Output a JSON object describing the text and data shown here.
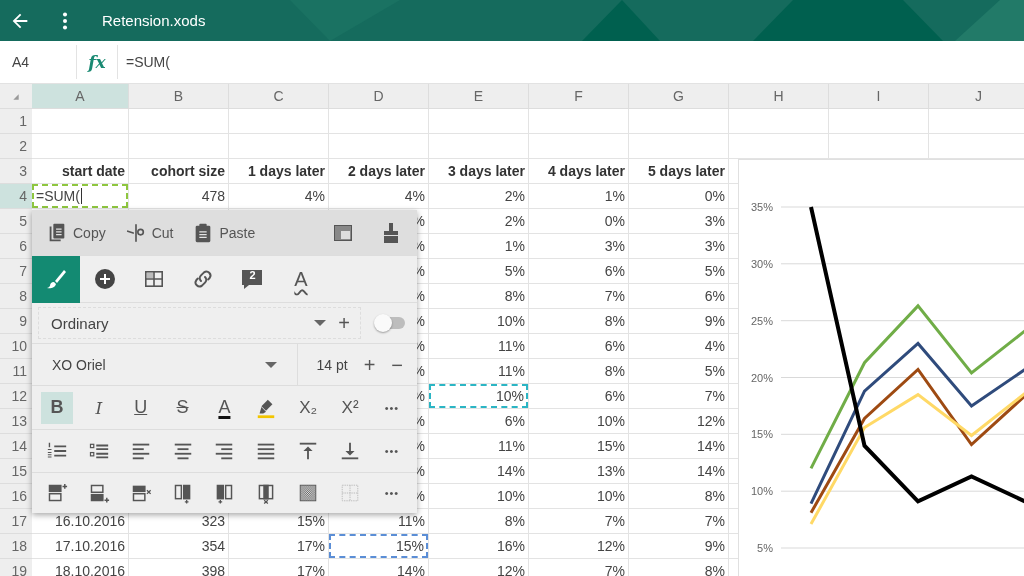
{
  "app_bar": {
    "title": "Retension.xods"
  },
  "formula_bar": {
    "cell_ref": "A4",
    "fx": "fx",
    "formula": "=SUM("
  },
  "sheet": {
    "columns": [
      {
        "label": "A",
        "selected": true
      },
      {
        "label": "B",
        "selected": false
      },
      {
        "label": "C",
        "selected": false
      },
      {
        "label": "D",
        "selected": false
      },
      {
        "label": "E",
        "selected": false
      },
      {
        "label": "F",
        "selected": false
      },
      {
        "label": "G",
        "selected": false
      },
      {
        "label": "H",
        "selected": false
      },
      {
        "label": "I",
        "selected": false
      },
      {
        "label": "J",
        "selected": false
      }
    ],
    "rows": [
      {
        "label": "1",
        "selected": false,
        "kind": "data",
        "cells": []
      },
      {
        "label": "2",
        "selected": false,
        "kind": "data",
        "cells": []
      },
      {
        "label": "3",
        "selected": false,
        "kind": "heading",
        "cells": [
          "start date",
          "cohort size",
          "1 days later",
          "2 days later",
          "3 days later",
          "4 days later",
          "5 days later"
        ]
      },
      {
        "label": "4",
        "selected": true,
        "kind": "data",
        "cells": [
          {
            "kind": "editing",
            "text": "=SUM("
          },
          "478",
          "4%",
          "4%",
          "2%",
          "1%",
          "0%"
        ]
      },
      {
        "label": "5",
        "selected": false,
        "kind": "data",
        "cells": [
          null,
          null,
          null,
          "%",
          "2%",
          "0%",
          "3%"
        ]
      },
      {
        "label": "6",
        "selected": false,
        "kind": "data",
        "cells": [
          null,
          null,
          null,
          "%",
          "1%",
          "3%",
          "3%"
        ]
      },
      {
        "label": "7",
        "selected": false,
        "kind": "data",
        "cells": [
          null,
          null,
          null,
          "%",
          "5%",
          "6%",
          "5%"
        ]
      },
      {
        "label": "8",
        "selected": false,
        "kind": "data",
        "cells": [
          null,
          null,
          null,
          "%",
          "8%",
          "7%",
          "6%"
        ]
      },
      {
        "label": "9",
        "selected": false,
        "kind": "data",
        "cells": [
          null,
          null,
          null,
          "%",
          "10%",
          "8%",
          "9%"
        ]
      },
      {
        "label": "10",
        "selected": false,
        "kind": "data",
        "cells": [
          null,
          null,
          null,
          "%",
          "11%",
          "6%",
          "4%"
        ]
      },
      {
        "label": "11",
        "selected": false,
        "kind": "data",
        "cells": [
          null,
          null,
          null,
          "%",
          "11%",
          "8%",
          "5%"
        ]
      },
      {
        "label": "12",
        "selected": false,
        "kind": "data",
        "cells": [
          null,
          null,
          null,
          "%",
          {
            "kind": "marquee",
            "text": "10%",
            "color": "#2bb5c4"
          },
          "6%",
          "7%"
        ]
      },
      {
        "label": "13",
        "selected": false,
        "kind": "data",
        "cells": [
          null,
          null,
          null,
          "%",
          "6%",
          "10%",
          "12%"
        ]
      },
      {
        "label": "14",
        "selected": false,
        "kind": "data",
        "cells": [
          null,
          null,
          null,
          "%",
          "11%",
          "15%",
          "14%"
        ]
      },
      {
        "label": "15",
        "selected": false,
        "kind": "data",
        "cells": [
          null,
          null,
          null,
          "%",
          "14%",
          "13%",
          "14%"
        ]
      },
      {
        "label": "16",
        "selected": false,
        "kind": "data",
        "cells": [
          null,
          null,
          null,
          "%",
          "10%",
          "10%",
          "8%"
        ]
      },
      {
        "label": "17",
        "selected": false,
        "kind": "data",
        "cells": [
          "16.10.2016",
          "323",
          "15%",
          "11%",
          "8%",
          "7%",
          "7%"
        ]
      },
      {
        "label": "18",
        "selected": false,
        "kind": "data",
        "cells": [
          "17.10.2016",
          "354",
          "17%",
          {
            "kind": "marquee",
            "text": "15%",
            "color": "#5b8ed6"
          },
          "16%",
          "12%",
          "9%"
        ]
      },
      {
        "label": "19",
        "selected": false,
        "kind": "data",
        "cells": [
          "18.10.2016",
          "398",
          "17%",
          "14%",
          "12%",
          "7%",
          "8%"
        ]
      }
    ],
    "chart_data": {
      "type": "line",
      "ylim": [
        5,
        35
      ],
      "grid": true,
      "yticks": [
        {
          "value": 5,
          "label": "5%"
        },
        {
          "value": 10,
          "label": "10%"
        },
        {
          "value": 15,
          "label": "15%"
        },
        {
          "value": 20,
          "label": "20%"
        },
        {
          "value": 25,
          "label": "25%"
        },
        {
          "value": 30,
          "label": "30%"
        },
        {
          "value": 35,
          "label": "35%"
        }
      ],
      "series": [
        {
          "color": "#70ad47",
          "values": [
            12.0,
            21.3,
            26.3,
            20.4,
            24.1
          ]
        },
        {
          "color": "#2f4b7c",
          "values": [
            8.9,
            18.8,
            23.0,
            17.5,
            20.7
          ]
        },
        {
          "color": "#9e4a12",
          "values": [
            8.1,
            16.4,
            20.7,
            14.1,
            18.4
          ]
        },
        {
          "color": "#ffd966",
          "values": [
            7.1,
            15.6,
            18.5,
            14.9,
            18.6
          ]
        },
        {
          "color": "#000000",
          "values": [
            35.0,
            14.0,
            9.1,
            11.3,
            9.1
          ]
        }
      ]
    }
  },
  "popup": {
    "clipboard": [
      {
        "kind": "copy",
        "label": "Copy"
      },
      {
        "kind": "cut",
        "label": "Cut"
      },
      {
        "kind": "paste",
        "label": "Paste"
      },
      {
        "kind": "fill"
      },
      {
        "kind": "format_painter"
      }
    ],
    "tabs": [
      {
        "kind": "brush",
        "selected": true
      },
      {
        "kind": "insert",
        "selected": false
      },
      {
        "kind": "table",
        "selected": false
      },
      {
        "kind": "link",
        "selected": false
      },
      {
        "kind": "comment",
        "badge": "2",
        "selected": false
      },
      {
        "kind": "text_style",
        "label": "A",
        "selected": false
      }
    ],
    "style_row": {
      "value": "Ordinary",
      "plus": "+",
      "toggle": {
        "on": false
      }
    },
    "font_row": {
      "font": "XO Oriel",
      "size": "14 pt",
      "increase": "+",
      "decrease": "−"
    },
    "format": [
      {
        "kind": "bold",
        "label": "B",
        "selected": true
      },
      {
        "kind": "italic",
        "label": "I",
        "selected": false
      },
      {
        "kind": "underline",
        "label": "U",
        "selected": false
      },
      {
        "kind": "strike",
        "label": "S",
        "selected": false
      },
      {
        "kind": "font_color",
        "label": "A",
        "selected": false
      },
      {
        "kind": "highlight",
        "selected": false
      },
      {
        "kind": "subscript",
        "label": "X₂",
        "selected": false
      },
      {
        "kind": "superscript",
        "label": "X²",
        "selected": false
      },
      {
        "kind": "more",
        "label": "•••",
        "selected": false
      }
    ],
    "paragraph": [
      {
        "kind": "numbered_list"
      },
      {
        "kind": "bullet_list"
      },
      {
        "kind": "align_left"
      },
      {
        "kind": "align_center"
      },
      {
        "kind": "align_right"
      },
      {
        "kind": "justify"
      },
      {
        "kind": "valign_top"
      },
      {
        "kind": "valign_bottom"
      },
      {
        "kind": "more",
        "label": "•••"
      }
    ],
    "cells": [
      {
        "kind": "insert_row_above",
        "disabled": false
      },
      {
        "kind": "insert_row_below",
        "disabled": false
      },
      {
        "kind": "delete_row",
        "disabled": false
      },
      {
        "kind": "insert_col_left",
        "disabled": false
      },
      {
        "kind": "insert_col_right",
        "disabled": false
      },
      {
        "kind": "delete_col",
        "disabled": false
      },
      {
        "kind": "fill_pattern",
        "disabled": false
      },
      {
        "kind": "borders",
        "disabled": true
      },
      {
        "kind": "more",
        "label": "•••",
        "disabled": false
      }
    ]
  }
}
